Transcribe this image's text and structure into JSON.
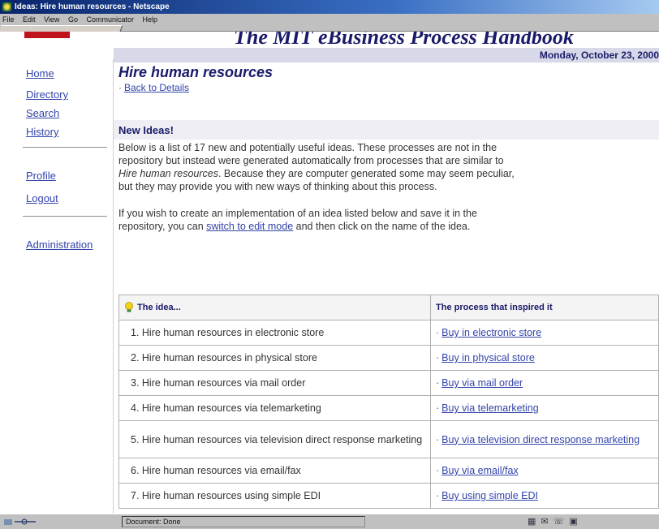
{
  "window": {
    "title": "Ideas: Hire human resources - Netscape"
  },
  "menu": [
    "File",
    "Edit",
    "View",
    "Go",
    "Communicator",
    "Help"
  ],
  "banner": {
    "site_title": "The MIT eBusiness Process Handbook",
    "date": "Monday, October 23, 2000"
  },
  "sidebar": {
    "items": [
      {
        "label": "Home"
      },
      {
        "label": "Directory"
      },
      {
        "label": "Search"
      },
      {
        "label": "History"
      },
      {
        "label": "Profile"
      },
      {
        "label": "Logout"
      },
      {
        "label": "Administration"
      }
    ]
  },
  "page": {
    "title": "Hire human resources",
    "back_link": "Back to Details",
    "section_title": "New Ideas!",
    "intro_lines": [
      "Below is a list of 17 new and potentially useful ideas. These processes are not in the",
      "repository but instead were generated automatically from processes that are similar to",
      "Hire human resources. Because they are computer generated some may seem peculiar,",
      "but they may provide you with new ways of thinking about this process."
    ],
    "intro_italic_term": "Hire human resources",
    "edit_line_1": "If you wish to create an implementation of an idea listed below and save it in the",
    "edit_line_2_before": "repository, you can ",
    "edit_link": "switch to edit mode",
    "edit_line_2_after": " and then click on the name of the idea."
  },
  "table": {
    "headers": [
      "The idea...",
      "The process that inspired it"
    ],
    "rows": [
      {
        "idea": "1. Hire human resources in electronic store",
        "process": "Buy in electronic store"
      },
      {
        "idea": "2. Hire human resources in physical store",
        "process": "Buy in physical store"
      },
      {
        "idea": "3. Hire human resources via mail order",
        "process": "Buy via mail order"
      },
      {
        "idea": "4. Hire human resources via telemarketing",
        "process": "Buy via telemarketing"
      },
      {
        "idea": "5. Hire human resources via television direct response marketing",
        "process": "Buy via television direct response marketing"
      },
      {
        "idea": "6. Hire human resources via email/fax",
        "process": "Buy via email/fax"
      },
      {
        "idea": "7. Hire human resources using simple EDI",
        "process": "Buy using simple EDI"
      }
    ]
  },
  "status": {
    "text": "Document: Done"
  }
}
